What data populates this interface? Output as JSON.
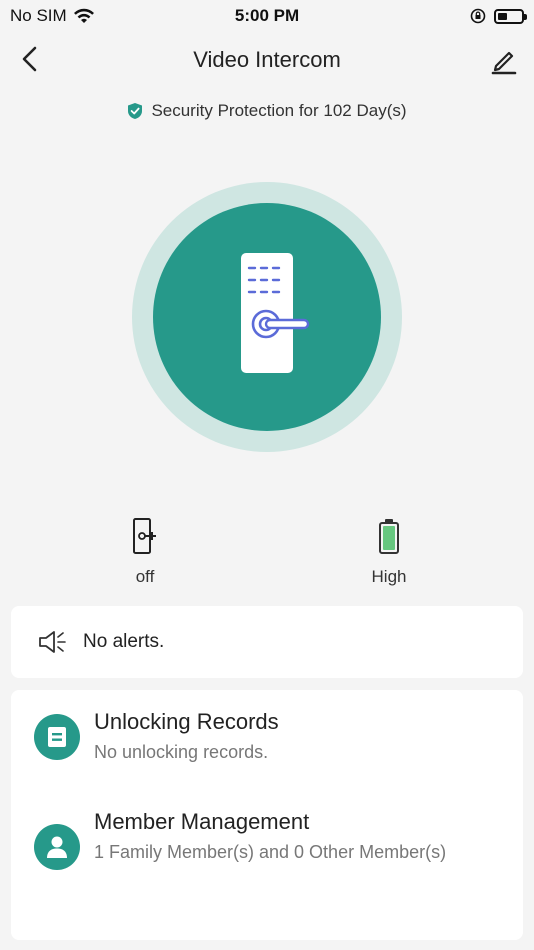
{
  "status_bar": {
    "carrier": "No SIM",
    "time": "5:00 PM"
  },
  "nav": {
    "title": "Video Intercom"
  },
  "protection": {
    "text": "Security Protection for 102 Day(s)"
  },
  "colors": {
    "accent": "#26998a",
    "ring": "#cfe6e2",
    "battery_green": "#66c77f"
  },
  "indicators": {
    "door_status": "off",
    "battery_level": "High"
  },
  "alert": {
    "text": "No alerts."
  },
  "menu": {
    "unlocking_records": {
      "title": "Unlocking Records",
      "subtitle": "No unlocking records."
    },
    "member_management": {
      "title": "Member Management",
      "subtitle": "1 Family Member(s) and 0 Other Member(s)"
    }
  }
}
